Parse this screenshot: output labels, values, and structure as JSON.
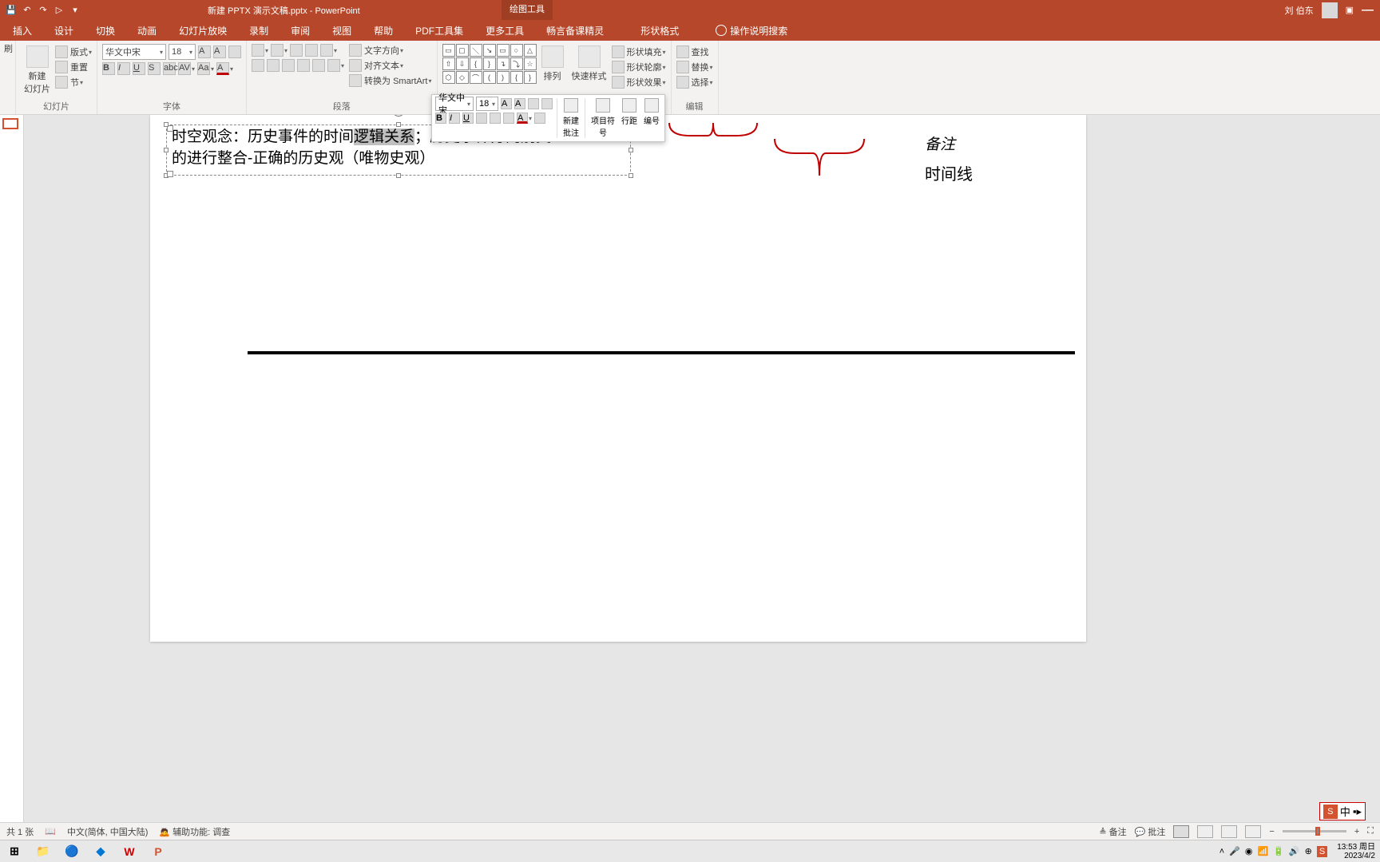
{
  "titlebar": {
    "title": "新建 PPTX 演示文稿.pptx - PowerPoint",
    "context_tab": "绘图工具",
    "user_name": "刘 伯东"
  },
  "ribbon": {
    "tabs": [
      "插入",
      "设计",
      "切换",
      "动画",
      "幻灯片放映",
      "录制",
      "审阅",
      "视图",
      "帮助",
      "PDF工具集",
      "更多工具",
      "畅言备课精灵",
      "形状格式"
    ],
    "search_placeholder": "操作说明搜索",
    "groups": {
      "slides": {
        "label": "幻灯片",
        "new_slide": "新建\n幻灯片",
        "layout": "版式",
        "reset": "重置",
        "section": "节"
      },
      "font": {
        "label": "字体",
        "font_name": "华文中宋",
        "font_size": "18"
      },
      "paragraph": {
        "label": "段落",
        "text_direction": "文字方向",
        "align_text": "对齐文本",
        "smartart": "转换为 SmartArt"
      },
      "drawing": {
        "label": "",
        "arrange": "排列",
        "quick_styles": "快速样式",
        "shape_fill": "形状填充",
        "shape_outline": "形状轮廓",
        "shape_effects": "形状效果"
      },
      "editing": {
        "label": "编辑",
        "find": "查找",
        "replace": "替换",
        "select": "选择"
      }
    }
  },
  "mini_toolbar": {
    "font_name": "华文中宋",
    "font_size": "18",
    "new_comment": "新建\n批注",
    "bullets": "项目符\n号",
    "line_spacing": "行距",
    "numbering": "编号"
  },
  "slide": {
    "text_line1_a": "时空观念：历史事件的时间",
    "text_line1_sel": "逻辑关系",
    "text_line1_b": "；历史事件分门别类",
    "text_line2": "的进行整合-正确的历史观（唯物史观）",
    "note_label": "备注",
    "timeline_label": "时间线"
  },
  "statusbar": {
    "slide_count": "共 1 张",
    "language": "中文(简体, 中国大陆)",
    "a11y": "辅助功能: 调查",
    "notes": "备注",
    "comments": "批注"
  },
  "taskbar": {
    "time": "13:53",
    "day": "周日",
    "date": "2023/4/2",
    "ime_mode": "中"
  }
}
